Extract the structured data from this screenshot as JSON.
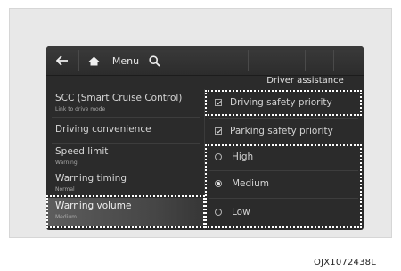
{
  "topbar": {
    "back_icon": "back-arrow-icon",
    "home_icon": "home-icon",
    "menu_label": "Menu",
    "search_icon": "search-icon"
  },
  "section": {
    "title": "Driver assistance"
  },
  "left_menu": [
    {
      "label": "SCC (Smart Cruise Control)",
      "sublabel": "Link to drive mode"
    },
    {
      "label": "Driving convenience",
      "sublabel": ""
    },
    {
      "label": "Speed limit",
      "sublabel": "Warning"
    },
    {
      "label": "Warning timing",
      "sublabel": "Normal"
    },
    {
      "label": "Warning volume",
      "sublabel": "Medium",
      "selected": true
    }
  ],
  "checkboxes": [
    {
      "label": "Driving safety priority",
      "checked": true
    },
    {
      "label": "Parking safety priority",
      "checked": true
    }
  ],
  "radio_options": [
    {
      "label": "High",
      "selected": false
    },
    {
      "label": "Medium",
      "selected": true
    },
    {
      "label": "Low",
      "selected": false
    }
  ],
  "caption": "OJX1072438L",
  "colors": {
    "screen_bg": "#2b2b2b",
    "frame_bg": "#e8e8e8",
    "highlight_dots": "#ffffff",
    "text": "#d6d6d6"
  }
}
